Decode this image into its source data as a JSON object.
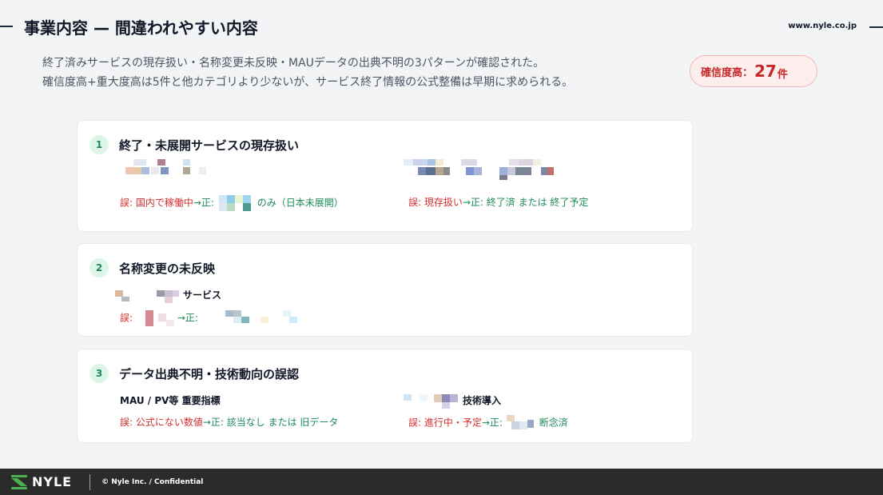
{
  "header": {
    "title": "事業内容 — 間違われやすい内容",
    "site_url": "www.nyle.co.jp"
  },
  "intro": {
    "line1": "終了済みサービスの現存扱い・名称変更未反映・MAUデータの出典不明の3パターンが確認された。",
    "line2": "確信度高+重大度高は5件と他カテゴリより少ないが、サービス終了情報の公式整備は早期に求められる。"
  },
  "badge": {
    "label": "確信度高：",
    "count": "27",
    "unit": "件",
    "color": "#c62828"
  },
  "cards": [
    {
      "number": "1",
      "title": "終了・未展開サービスの現存扱い",
      "items": [
        {
          "wrong": "誤: 国内で稼働中",
          "arrow": "→",
          "right_prefix": "正: ",
          "right_suffix": "のみ（日本未展開）"
        },
        {
          "wrong": "誤: 現存扱い",
          "arrow": "→",
          "right": "正: 終了済 または 終了予定"
        }
      ]
    },
    {
      "number": "2",
      "title": "名称変更の未反映",
      "items": [
        {
          "name_suffix": "サービス",
          "wrong": "誤: ",
          "arrow": "→",
          "right_prefix": "正: "
        }
      ]
    },
    {
      "number": "3",
      "title": "データ出典不明・技術動向の誤認",
      "items": [
        {
          "name": "MAU / PV等 重要指標",
          "wrong": "誤: 公式にない数値",
          "arrow": "→",
          "right": "正: 該当なし または 旧データ"
        },
        {
          "name_suffix": "技術導入",
          "wrong": "誤: 進行中・予定",
          "arrow": "→",
          "right_prefix": "正: ",
          "right_suffix": "断念済"
        }
      ]
    }
  ],
  "footer": {
    "logo": "NYLE",
    "copyright": "© Nyle Inc. / Confidential"
  },
  "colors": {
    "accent_green": "#1f8a5a",
    "error_red": "#d32f2f",
    "footer_bg": "#2b2b2b"
  }
}
